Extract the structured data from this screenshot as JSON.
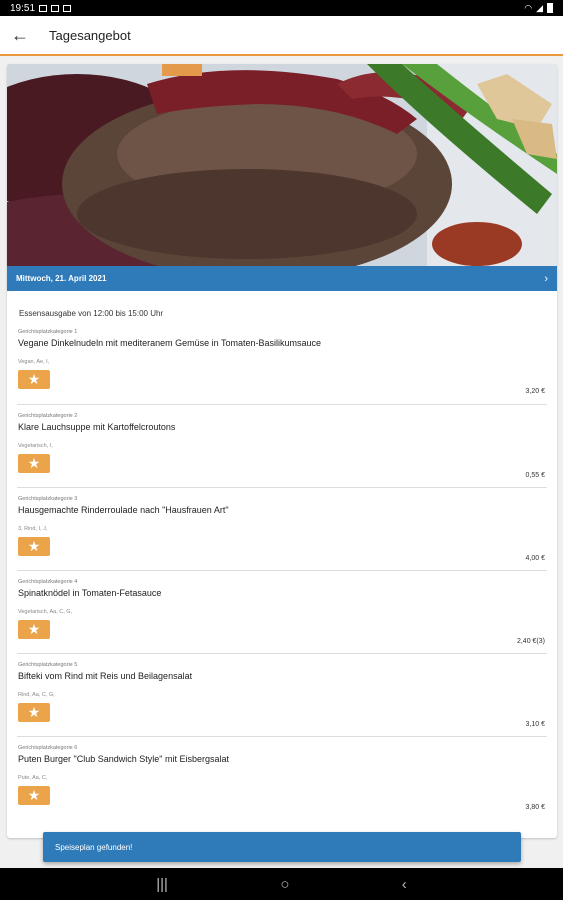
{
  "status": {
    "time": "19:51"
  },
  "app_bar": {
    "title": "Tagesangebot"
  },
  "date_bar": {
    "date": "Mittwoch, 21. April 2021",
    "chevron": "›"
  },
  "serving_time": "Essensausgabe von 12:00 bis 15:00 Uhr",
  "items": [
    {
      "category": "Gerichtsplatzkategorie 1",
      "name": "Vegane Dinkelnudeln mit mediteranem Gemüse in Tomaten-Basilikumsauce",
      "allergens": "Vegan, Ae, I,",
      "price": "3,20 €"
    },
    {
      "category": "Gerichtsplatzkategorie 2",
      "name": "Klare Lauchsuppe mit Kartoffelcroutons",
      "allergens": "Vegetarisch, I,",
      "price": "0,55 €"
    },
    {
      "category": "Gerichtsplatzkategorie 3",
      "name": "Hausgemachte Rinderroulade nach \"Hausfrauen Art\"",
      "allergens": "3, Rind, I, J,",
      "price": "4,00 €"
    },
    {
      "category": "Gerichtsplatzkategorie 4",
      "name": "Spinatknödel in Tomaten-Fetasauce",
      "allergens": "Vegetarisch, Aa, C, G,",
      "price": "2,40 €(3)"
    },
    {
      "category": "Gerichtsplatzkategorie 5",
      "name": "Bifteki vom Rind mit Reis und Beilagensalat",
      "allergens": "Rind, Aa, C, G,",
      "price": "3,10 €"
    },
    {
      "category": "Gerichtsplatzkategorie 6",
      "name": "Puten Burger \"Club Sandwich Style\" mit Eisbergsalat",
      "allergens": "Pute, Aa, C,",
      "price": "3,80 €"
    }
  ],
  "snackbar": {
    "text": "Speiseplan gefunden!"
  },
  "icons": {
    "back": "arrow-left",
    "star": "star",
    "chevron": "chevron-right"
  },
  "colors": {
    "accent_orange": "#e8983a",
    "primary_blue": "#2f7ab8",
    "star_bg": "#eba44a"
  }
}
